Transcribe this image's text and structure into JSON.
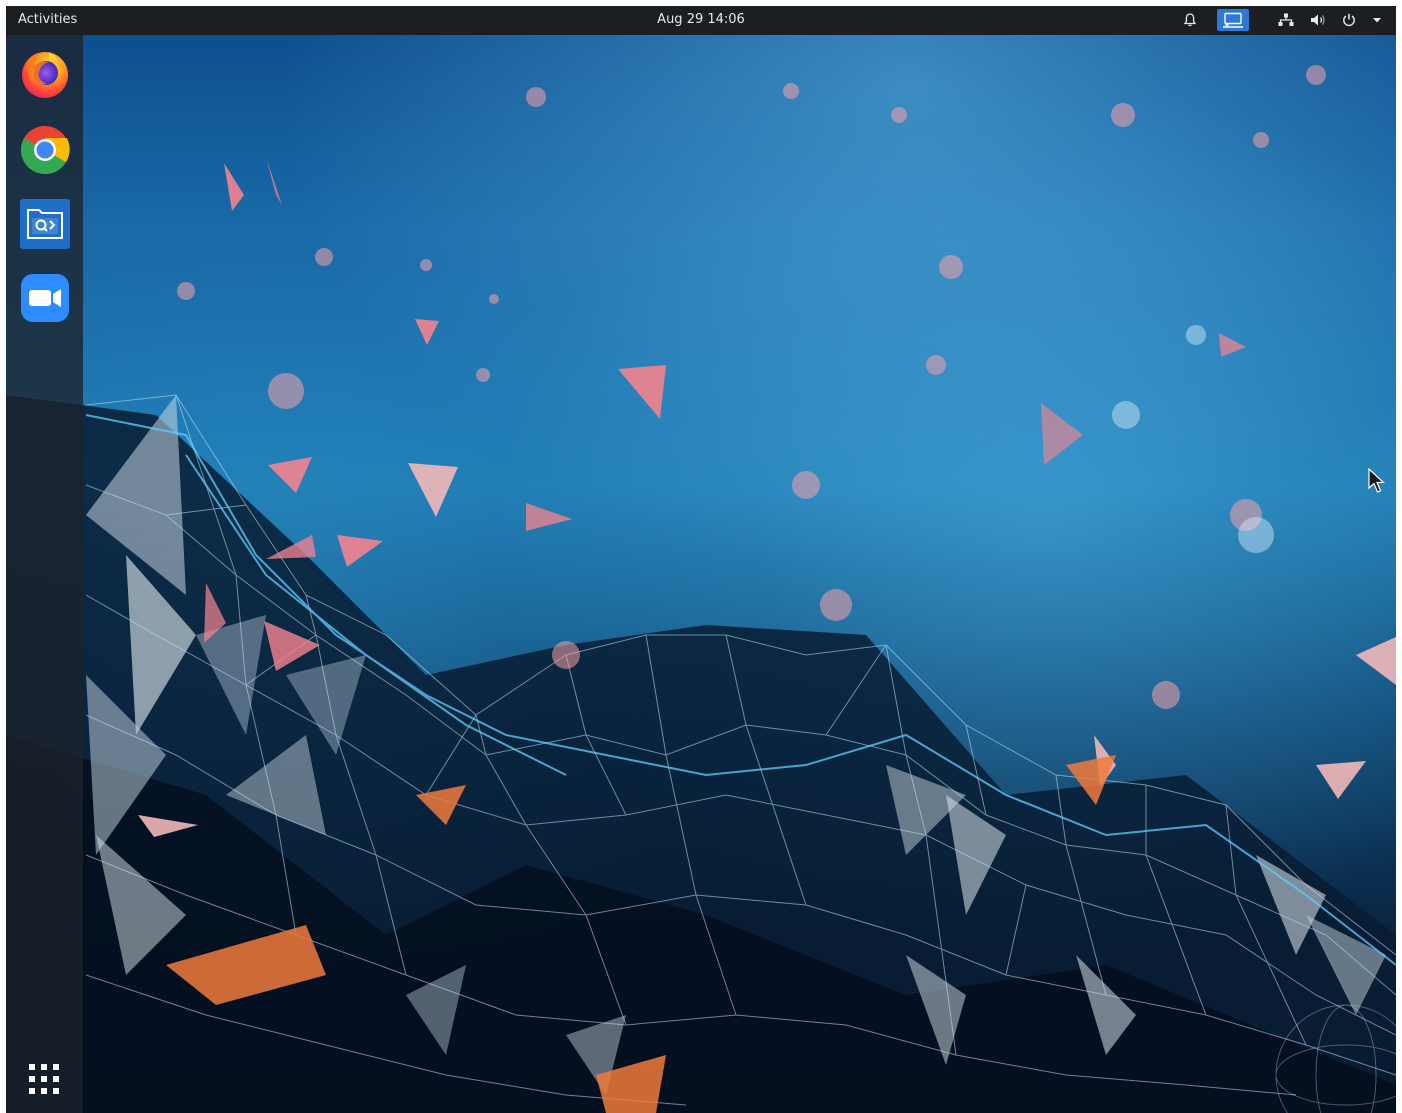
{
  "topbar": {
    "activities_label": "Activities",
    "clock": "Aug 29  14:06",
    "icons": [
      "bell-icon",
      "screencast-icon",
      "network-icon",
      "volume-icon",
      "power-icon",
      "caret-down-icon"
    ],
    "cast_accent": "#2c7ad6"
  },
  "dock": {
    "apps": [
      "firefox-icon",
      "chrome-icon",
      "remote-desktop-icon",
      "zoom-icon"
    ],
    "show_apps_icon": "grid-icon"
  },
  "colors": {
    "topbar_bg": "#1c1f22",
    "wallpaper_top": "#1f73b2",
    "wallpaper_bottom": "#06142a",
    "triangle_accent": "#f4848f",
    "orange_accent": "#f07a3c"
  }
}
